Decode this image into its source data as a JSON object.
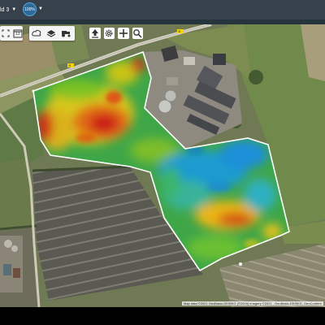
{
  "header": {
    "field_name": "ld 3",
    "zoom_level": "100%"
  },
  "toolbar": {
    "calendar_day": "13",
    "icons": [
      "fullscreen-icon",
      "calendar-icon",
      "weather-icon",
      "layers-icon",
      "tractor-icon",
      "upload-icon",
      "settings-icon",
      "add-icon",
      "search-icon"
    ]
  },
  "map": {
    "attribution": "Map data ©2021 GeoBasis-DE/BKG (©2009) Imagery ©2021 , GeoBasis-DE/BKG, GeoContent",
    "road_label": "B"
  }
}
